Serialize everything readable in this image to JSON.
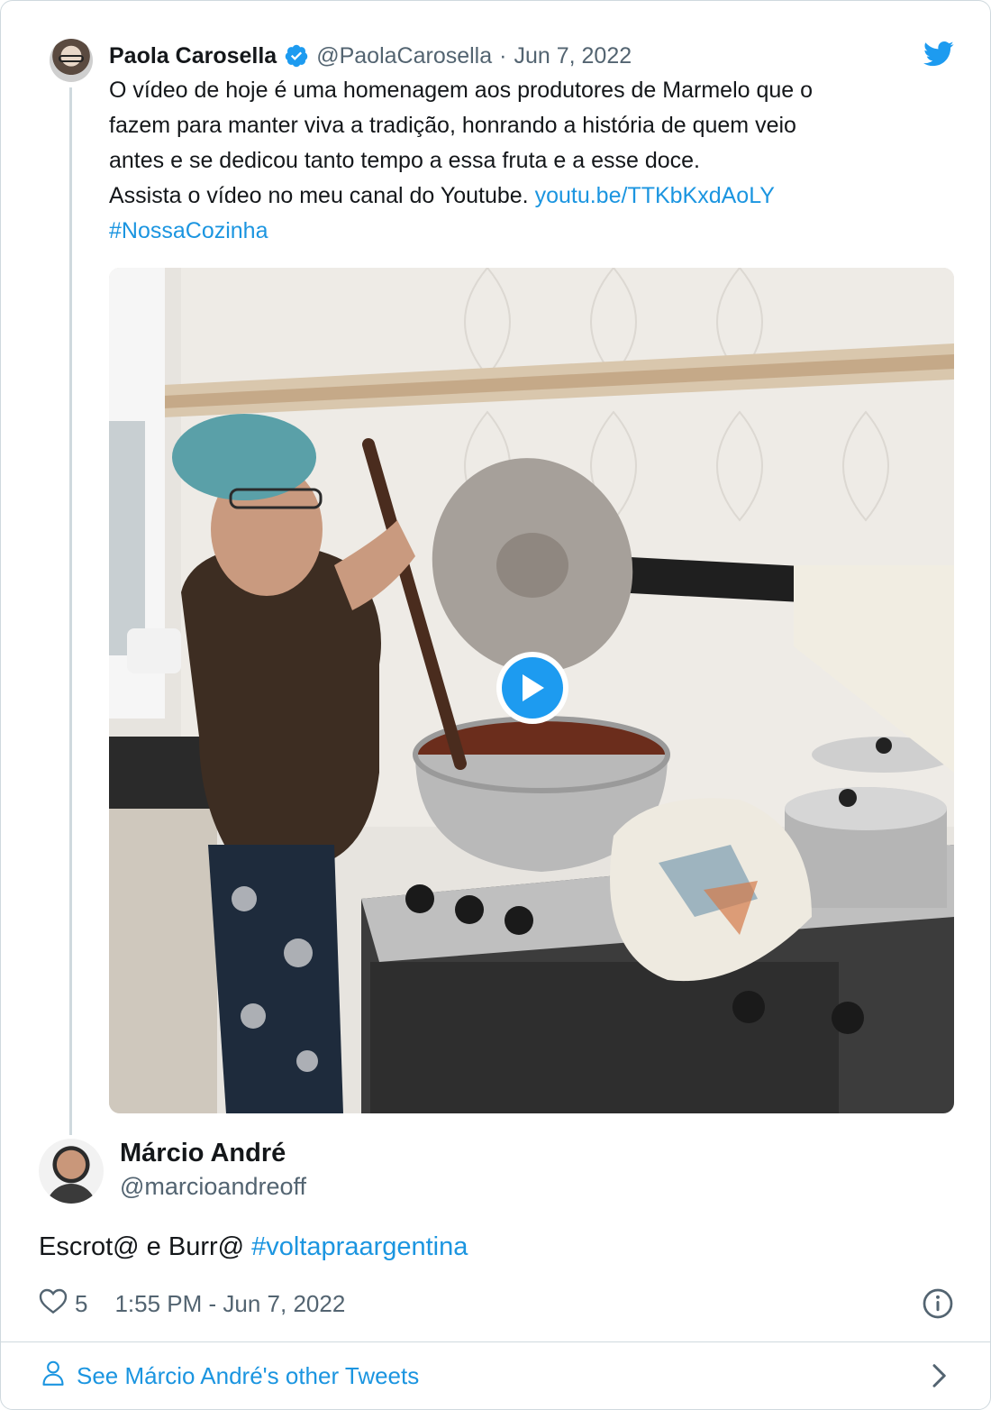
{
  "quoted_tweet": {
    "author_name": "Paola Carosella",
    "handle": "@PaolaCarosella",
    "separator": "·",
    "date": "Jun 7, 2022",
    "verified_icon": "verified-badge-icon",
    "text_lines": [
      "O vídeo de hoje é uma homenagem aos produtores de Marmelo que o",
      "fazem para manter viva a tradição, honrando a história de quem veio",
      "antes e se dedicou tanto tempo a essa fruta e a esse doce.",
      "Assista o vídeo no meu canal do Youtube. "
    ],
    "link": "youtu.be/TTKbKxdAoLY",
    "hashtag": "#NossaCozinha",
    "media": {
      "type": "video",
      "play_icon": "play-icon"
    }
  },
  "brand_icon": "twitter-bird-icon",
  "tweet": {
    "author_name": "Márcio André",
    "handle": "@marcioandreoff",
    "text_plain": "Escrot@ e Burr@ ",
    "hashtag": "#voltapraargentina",
    "like_count": "5",
    "timestamp": "1:55 PM - Jun 7, 2022"
  },
  "footer": {
    "label": "See Márcio André's other Tweets",
    "icon": "person-icon",
    "chevron": "chevron-right-icon"
  },
  "colors": {
    "accent": "#1b95e0",
    "play_blue": "#1d9bf0",
    "text": "#14171a",
    "secondary": "#536471",
    "border": "#cfd9de"
  }
}
